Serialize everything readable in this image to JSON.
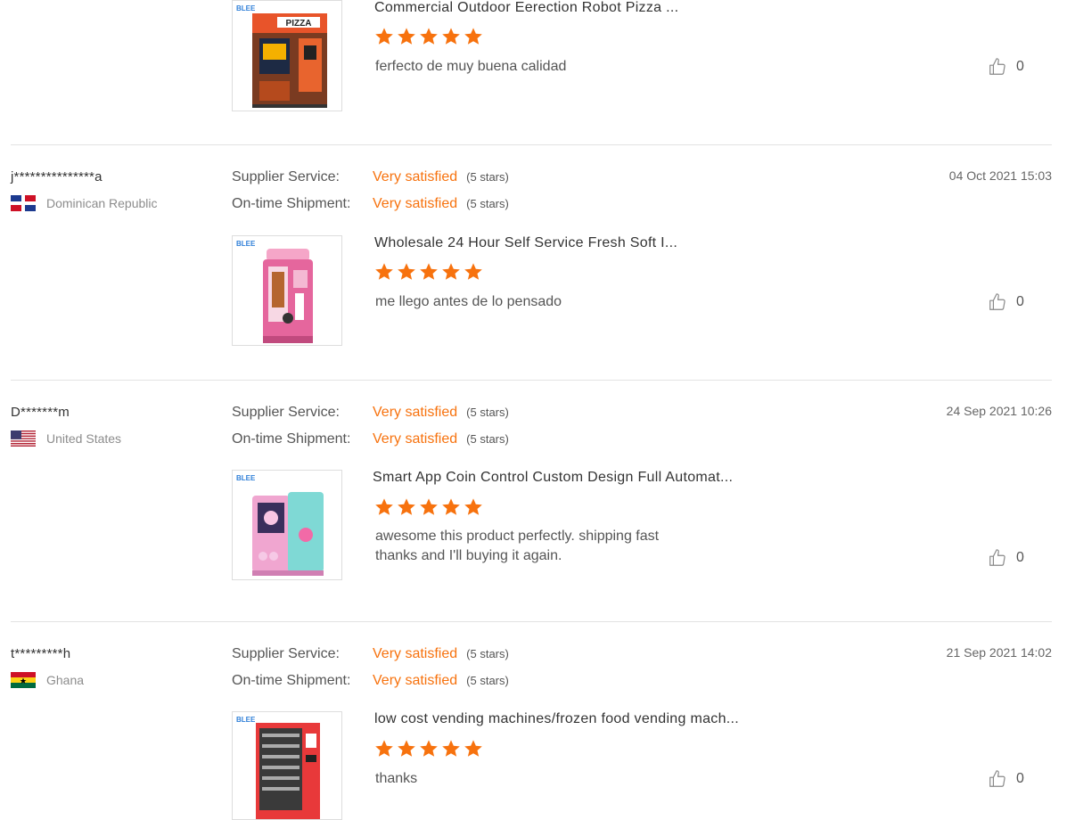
{
  "colors": {
    "accent": "#f7720e",
    "divider": "#e3e3e3",
    "muted": "#8c8c8c"
  },
  "reviews": [
    {
      "buyer": "",
      "country": "",
      "supplier_service_label": "",
      "supplier_service_value": "",
      "supplier_service_stars": "",
      "shipment_label": "",
      "shipment_value": "",
      "shipment_stars": "",
      "date": "",
      "brand": "BLEE",
      "product_title": "Commercial Outdoor Eerection Robot Pizza ...",
      "product_rating": 5,
      "comment": "ferfecto de muy buena calidad",
      "likes": "0"
    },
    {
      "buyer": "j***************a",
      "country": "Dominican Republic",
      "supplier_service_label": "Supplier Service:",
      "supplier_service_value": "Very satisfied",
      "supplier_service_stars": "(5 stars)",
      "shipment_label": "On-time Shipment:",
      "shipment_value": "Very satisfied",
      "shipment_stars": "(5 stars)",
      "date": "04 Oct 2021 15:03",
      "brand": "BLEE",
      "product_title": "Wholesale 24 Hour Self Service Fresh Soft I...",
      "product_rating": 5,
      "comment": "me llego antes de lo pensado",
      "likes": "0"
    },
    {
      "buyer": "D*******m",
      "country": "United States",
      "supplier_service_label": "Supplier Service:",
      "supplier_service_value": "Very satisfied",
      "supplier_service_stars": "(5 stars)",
      "shipment_label": "On-time Shipment:",
      "shipment_value": "Very satisfied",
      "shipment_stars": "(5 stars)",
      "date": "24 Sep 2021 10:26",
      "brand": "BLEE",
      "product_title": "Smart App Coin Control Custom Design Full Automat...",
      "product_rating": 5,
      "comment": "awesome this product perfectly. shipping fast\nthanks and I'll buying it again.",
      "likes": "0"
    },
    {
      "buyer": "t*********h",
      "country": "Ghana",
      "supplier_service_label": "Supplier Service:",
      "supplier_service_value": "Very satisfied",
      "supplier_service_stars": "(5 stars)",
      "shipment_label": "On-time Shipment:",
      "shipment_value": "Very satisfied",
      "shipment_stars": "(5 stars)",
      "date": "21 Sep 2021 14:02",
      "brand": "BLEE",
      "product_title": "low cost vending machines/frozen food vending mach...",
      "product_rating": 5,
      "comment": "thanks",
      "likes": "0"
    }
  ],
  "icons": {
    "product_star": "star-icon",
    "like": "thumbs-up-icon"
  }
}
